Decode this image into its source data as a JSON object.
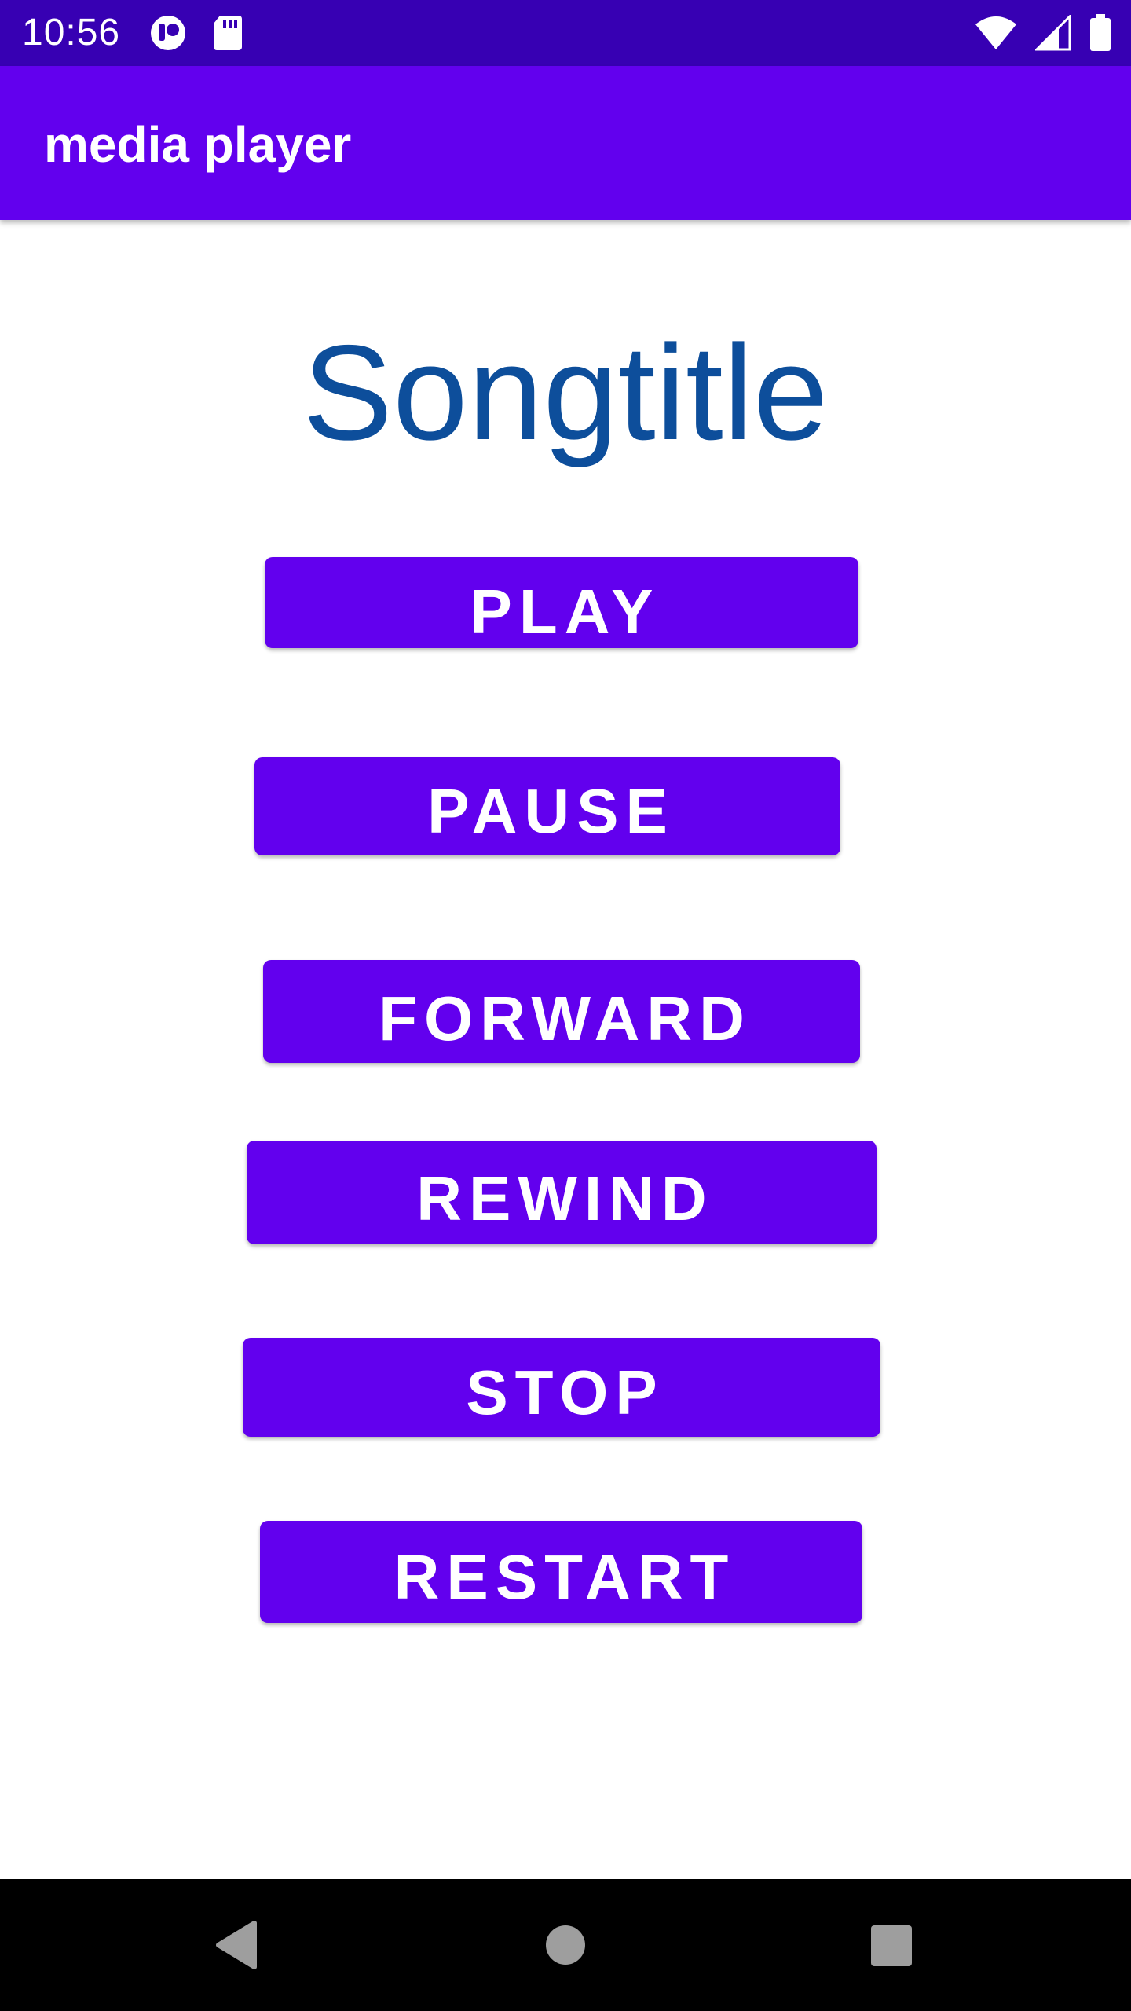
{
  "status_bar": {
    "time": "10:56",
    "icons": [
      "app-notification-icon",
      "sd-card-icon",
      "wifi-icon",
      "signal-icon",
      "battery-icon"
    ]
  },
  "app_bar": {
    "title": "media player"
  },
  "main": {
    "song_title": "Songtitle",
    "buttons": {
      "play": "PLAY",
      "pause": "PAUSE",
      "forward": "FORWARD",
      "rewind": "REWIND",
      "stop": "STOP",
      "restart": "RESTART"
    }
  },
  "nav_bar": {
    "icons": [
      "back-icon",
      "home-icon",
      "recents-icon"
    ]
  },
  "colors": {
    "status_bar": "#3700B3",
    "primary": "#6200EE",
    "song_title": "#0D4E9B",
    "nav_bar": "#000000"
  }
}
